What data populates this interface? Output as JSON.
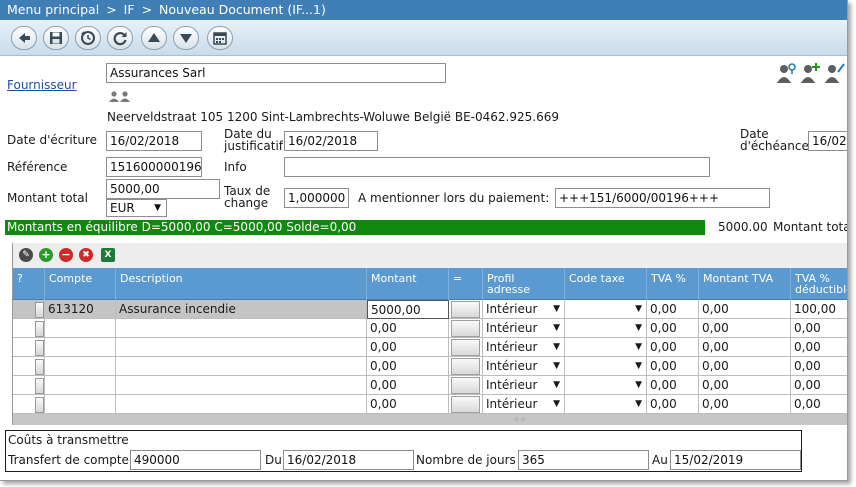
{
  "titlebar": {
    "menu": "Menu principal",
    "sep1": ">",
    "module": "IF",
    "sep2": ">",
    "document": "Nouveau Document (IF...1)"
  },
  "toolbar": {
    "buttons": [
      "back",
      "save",
      "history",
      "refresh",
      "move-up",
      "move-down",
      "calendar"
    ]
  },
  "supplier": {
    "label": "Fournisseur",
    "name": "Assurances Sarl",
    "address": "Neerveldstraat 105 1200 Sint-Lambrechts-Woluwe België BE-0462.925.669"
  },
  "dates": {
    "ecriture_label": "Date d'écriture",
    "ecriture_value": "16/02/2018",
    "justificatif_label_1": "Date du",
    "justificatif_label_2": "justificatif",
    "justificatif_value": "16/02/2018",
    "echeance_label_1": "Date",
    "echeance_label_2": "d'échéance",
    "echeance_value": "16/02"
  },
  "reference": {
    "label": "Référence",
    "value": "151600000196"
  },
  "info": {
    "label": "Info",
    "value": ""
  },
  "amount": {
    "label": "Montant total",
    "value": "5000,00",
    "currency": "EUR"
  },
  "exchange": {
    "label_1": "Taux de",
    "label_2": "change",
    "value": "1,000000"
  },
  "payment": {
    "label": "A mentionner lors du paiement:",
    "value": "+++151/6000/00196+++"
  },
  "balance": {
    "status": "Montants en équilibre D=5000,00 C=5000,00 Solde=0,00",
    "total_value": "5000.00",
    "total_label": "Montant tota"
  },
  "grid": {
    "columns": {
      "q": "?",
      "compte": "Compte",
      "description": "Description",
      "montant": "Montant",
      "eq": "=",
      "profil_1": "Profil",
      "profil_2": "adresse",
      "code_taxe": "Code taxe",
      "tva_pct": "TVA %",
      "montant_tva": "Montant TVA",
      "tva_ded_1": "TVA %",
      "tva_ded_2": "déductible"
    },
    "rows": [
      {
        "compte": "613120",
        "description": "Assurance incendie",
        "montant": "5000,00",
        "profil": "Intérieur",
        "code_taxe": "",
        "tva_pct": "0,00",
        "montant_tva": "0,00",
        "tva_ded": "100,00"
      },
      {
        "compte": "",
        "description": "",
        "montant": "0,00",
        "profil": "Intérieur",
        "code_taxe": "",
        "tva_pct": "0,00",
        "montant_tva": "0,00",
        "tva_ded": "0,00"
      },
      {
        "compte": "",
        "description": "",
        "montant": "0,00",
        "profil": "Intérieur",
        "code_taxe": "",
        "tva_pct": "0,00",
        "montant_tva": "0,00",
        "tva_ded": "0,00"
      },
      {
        "compte": "",
        "description": "",
        "montant": "0,00",
        "profil": "Intérieur",
        "code_taxe": "",
        "tva_pct": "0,00",
        "montant_tva": "0,00",
        "tva_ded": "0,00"
      },
      {
        "compte": "",
        "description": "",
        "montant": "0,00",
        "profil": "Intérieur",
        "code_taxe": "",
        "tva_pct": "0,00",
        "montant_tva": "0,00",
        "tva_ded": "0,00"
      },
      {
        "compte": "",
        "description": "",
        "montant": "0,00",
        "profil": "Intérieur",
        "code_taxe": "",
        "tva_pct": "0,00",
        "montant_tva": "0,00",
        "tva_ded": "0,00"
      }
    ]
  },
  "costs": {
    "title": "Coûts à transmettre",
    "transfer_label": "Transfert de compte",
    "transfer_value": "490000",
    "du_label": "Du",
    "du_value": "16/02/2018",
    "days_label": "Nombre de jours",
    "days_value": "365",
    "au_label": "Au",
    "au_value": "15/02/2019"
  },
  "colors": {
    "titlebar": "#3f7fb5",
    "balance_ok": "#0f8a0f",
    "grid_header": "#5a9ad1"
  }
}
